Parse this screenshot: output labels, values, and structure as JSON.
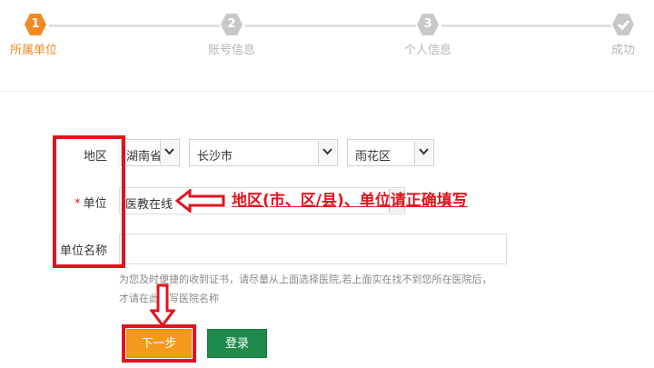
{
  "steps": [
    {
      "num": "1",
      "label": "所属单位",
      "state": "active"
    },
    {
      "num": "2",
      "label": "账号信息",
      "state": "inactive"
    },
    {
      "num": "3",
      "label": "个人信息",
      "state": "inactive"
    },
    {
      "num": "",
      "label": "成功",
      "state": "inactive",
      "icon": "check-icon"
    }
  ],
  "form": {
    "region_label": "地区",
    "province": "湖南省",
    "city": "长沙市",
    "district": "雨花区",
    "unit_label": "单位",
    "unit_required_mark": "*",
    "unit_value": "医教在线",
    "unit_name_label": "单位名称",
    "unit_name_value": "",
    "hint_line1": "为您及时便捷的收到证书，请尽量从上面选择医院,若上面实在找不到您所在医院后，",
    "hint_line2": "才请在此填写医院名称"
  },
  "annotation": "地区(市、区/县)、单位请正确填写",
  "buttons": {
    "next": "下一步",
    "login": "登录"
  },
  "colors": {
    "accent": "#f08a24",
    "step_inactive": "#c8c8c8",
    "annotation_red": "#e0141e",
    "next_button": "#f39a1d",
    "login_button": "#1e8a4c"
  }
}
